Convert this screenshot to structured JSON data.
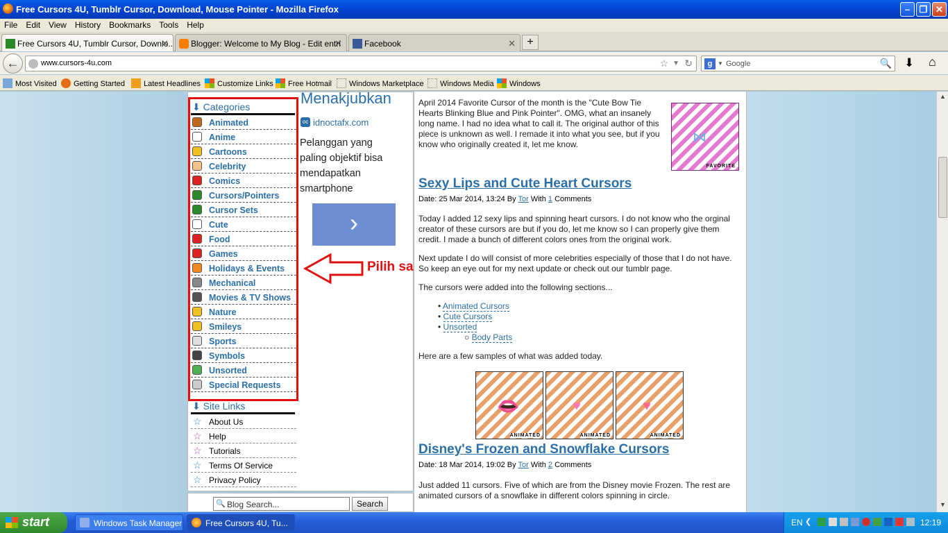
{
  "window": {
    "title": "Free Cursors 4U, Tumblr Cursor, Download, Mouse Pointer - Mozilla Firefox"
  },
  "menu": [
    "File",
    "Edit",
    "View",
    "History",
    "Bookmarks",
    "Tools",
    "Help"
  ],
  "tabs": [
    {
      "label": "Free Cursors 4U, Tumblr Cursor, Downlo...",
      "active": true
    },
    {
      "label": "Blogger: Welcome to My Blog - Edit entri",
      "active": false
    },
    {
      "label": "Facebook",
      "active": false
    }
  ],
  "new_tab": "+",
  "address": {
    "url": "www.cursors-4u.com"
  },
  "search": {
    "engine": "g",
    "placeholder": "Google"
  },
  "bookmarks": [
    "Most Visited",
    "Getting Started",
    "Latest Headlines",
    "Customize Links",
    "Free Hotmail",
    "Windows Marketplace",
    "Windows Media",
    "Windows"
  ],
  "sidebar": {
    "ad": {
      "title": "Menakjubkan",
      "source": "idnoctafx.com",
      "body": "Pelanggan yang paling objektif bisa mendapatkan smartphone",
      "button": "›"
    },
    "categories_title": "Categories",
    "categories": [
      "Animated",
      "Anime",
      "Cartoons",
      "Celebrity",
      "Comics",
      "Cursors/Pointers",
      "Cursor Sets",
      "Cute",
      "Food",
      "Games",
      "Holidays & Events",
      "Mechanical",
      "Movies & TV Shows",
      "Nature",
      "Smileys",
      "Sports",
      "Symbols",
      "Unsorted",
      "Special Requests"
    ],
    "site_links_title": "Site Links",
    "site_links": [
      "About Us",
      "Help",
      "Tutorials",
      "Terms Of Service",
      "Privacy Policy"
    ],
    "search_placeholder": "Blog Search...",
    "search_button": "Search"
  },
  "annotation": {
    "text": "Pilih salah satu kategori berikut",
    "color": "#e01010"
  },
  "content": {
    "intro": "April 2014 Favorite Cursor of the month is the \"Cute Bow Tie Hearts Blinking Blue and Pink Pointer\". OMG, what an insanely long name. I had no idea what to call it. The original author of this piece is unknown as well. I remade it into what you see, but if you know who originally created it, let me know.",
    "favorite_label": "FAVORITE",
    "post1": {
      "title": "Sexy Lips and Cute Heart Cursors",
      "meta_date": "Date: 25 Mar 2014, 13:24 By ",
      "meta_author": "Tor",
      "meta_with": " With ",
      "meta_count": "1",
      "meta_comments": " Comments",
      "p1": "Today I added 12 sexy lips and spinning heart cursors. I do not know who the orginal creator of these cursors are but if you do, let me know so I can properly give them credit. I made a bunch of different colors ones from the original work.",
      "p2": "Next update I do will consist of more celebrities especially of those that I do not have. So keep an eye out for my next update or check out our tumblr page.",
      "p3": "The cursors were added into the following sections...",
      "sections": [
        "Animated Cursors",
        "Cute Cursors",
        "Unsorted"
      ],
      "subsection": "Body Parts",
      "p4": "Here are a few samples of what was added today.",
      "sample_label": "ANIMATED"
    },
    "post2": {
      "title": "Disney's Frozen and Snowflake Cursors",
      "meta_date": "Date: 18 Mar 2014, 19:02 By ",
      "meta_author": "Tor",
      "meta_with": " With ",
      "meta_count": "2",
      "meta_comments": " Comments",
      "p1": "Just added 11 cursors. Five of which are from the Disney movie Frozen. The rest are animated cursors of a snowflake in different colors spinning in circle."
    }
  },
  "taskbar": {
    "start": "start",
    "items": [
      {
        "label": "Windows Task Manager",
        "active": false
      },
      {
        "label": "Free Cursors 4U, Tu...",
        "active": true
      }
    ],
    "lang": "EN",
    "time": "12:19"
  }
}
